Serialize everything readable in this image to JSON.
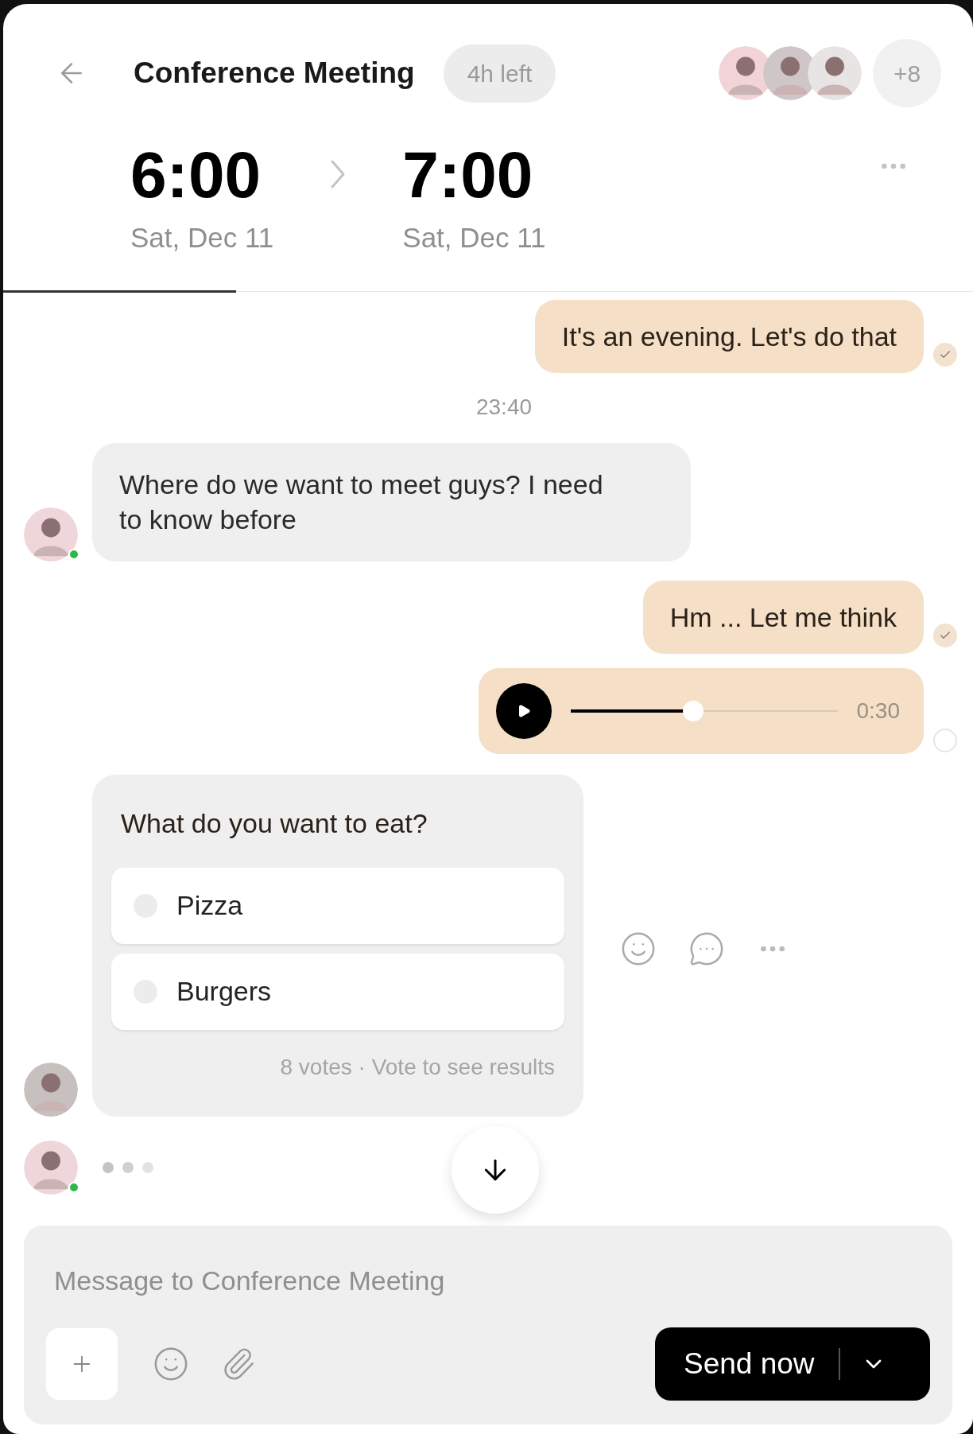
{
  "header": {
    "title": "Conference Meeting",
    "badge": "4h left",
    "participants": [
      {
        "color": "#f1d3d8"
      },
      {
        "color": "#cfc6c8"
      },
      {
        "color": "#e9e4e4"
      }
    ],
    "extra_count": "+8"
  },
  "schedule": {
    "start": {
      "time": "6:00",
      "date": "Sat, Dec 11"
    },
    "end": {
      "time": "7:00",
      "date": "Sat, Dec 11"
    },
    "progress": {
      "level": 0.24
    }
  },
  "messages": [
    {
      "kind": "text",
      "outgoing": true,
      "text": "It's an evening. Let's do that",
      "read": true
    },
    {
      "kind": "timestamp",
      "text": "23:40"
    },
    {
      "kind": "text",
      "outgoing": false,
      "text": "Where do we want to meet guys? I need to know before",
      "online": true
    },
    {
      "kind": "text",
      "outgoing": true,
      "text": "Hm ... Let me think",
      "read": true
    },
    {
      "kind": "voice",
      "outgoing": true,
      "duration": "0:30",
      "level": 0.46,
      "read": false
    },
    {
      "kind": "poll",
      "outgoing": false,
      "question": "What do you want to eat?",
      "options": [
        {
          "label": "Pizza",
          "selected": false
        },
        {
          "label": "Burgers",
          "selected": false
        }
      ],
      "footer": "8 votes · Vote to see results",
      "online": false
    },
    {
      "kind": "typing",
      "outgoing": false,
      "online": true
    }
  ],
  "composer": {
    "placeholder": "Message to Conference Meeting",
    "send_label": "Send now"
  }
}
